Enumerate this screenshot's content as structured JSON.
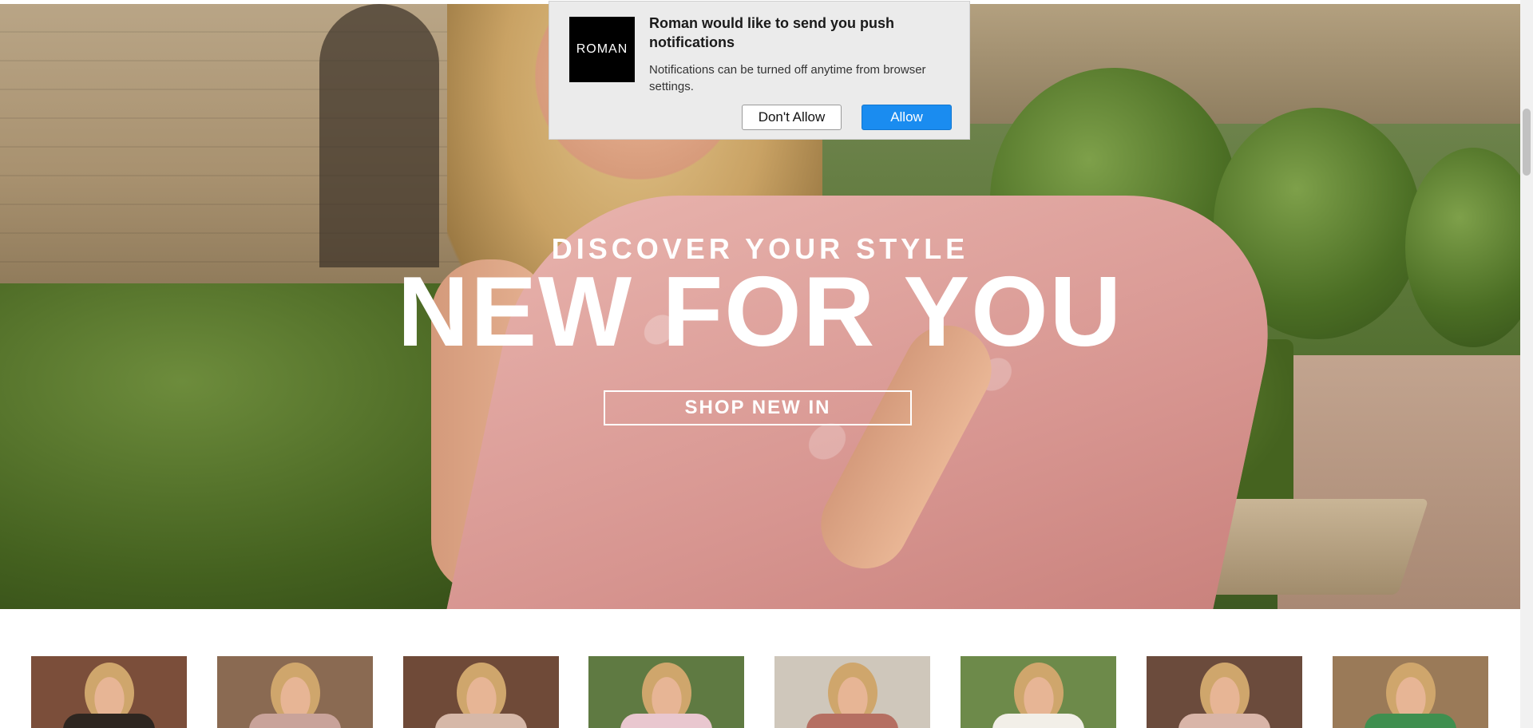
{
  "hero": {
    "eyebrow": "DISCOVER YOUR STYLE",
    "headline": "NEW FOR YOU",
    "cta_label": "SHOP NEW IN"
  },
  "notification": {
    "logo_text": "ROMAN",
    "title": "Roman would like to send you push notifications",
    "message": "Notifications can be turned off anytime from browser settings.",
    "deny_label": "Don't Allow",
    "allow_label": "Allow",
    "allow_color": "#1a8cf0"
  },
  "products": [
    {
      "name": "product-thumb-1",
      "palette": [
        "#7b4e3a",
        "#2e2620"
      ]
    },
    {
      "name": "product-thumb-2",
      "palette": [
        "#8a6a52",
        "#c9a39a"
      ]
    },
    {
      "name": "product-thumb-3",
      "palette": [
        "#6f4a38",
        "#d6b8a8"
      ]
    },
    {
      "name": "product-thumb-4",
      "palette": [
        "#5f7a42",
        "#e9c7cf"
      ]
    },
    {
      "name": "product-thumb-5",
      "palette": [
        "#cfc7bb",
        "#b56f62"
      ]
    },
    {
      "name": "product-thumb-6",
      "palette": [
        "#6d8a4a",
        "#f2efe8"
      ]
    },
    {
      "name": "product-thumb-7",
      "palette": [
        "#6b4b3c",
        "#d9b5a8"
      ]
    },
    {
      "name": "product-thumb-8",
      "palette": [
        "#9a7a58",
        "#3f8f4f"
      ]
    }
  ]
}
